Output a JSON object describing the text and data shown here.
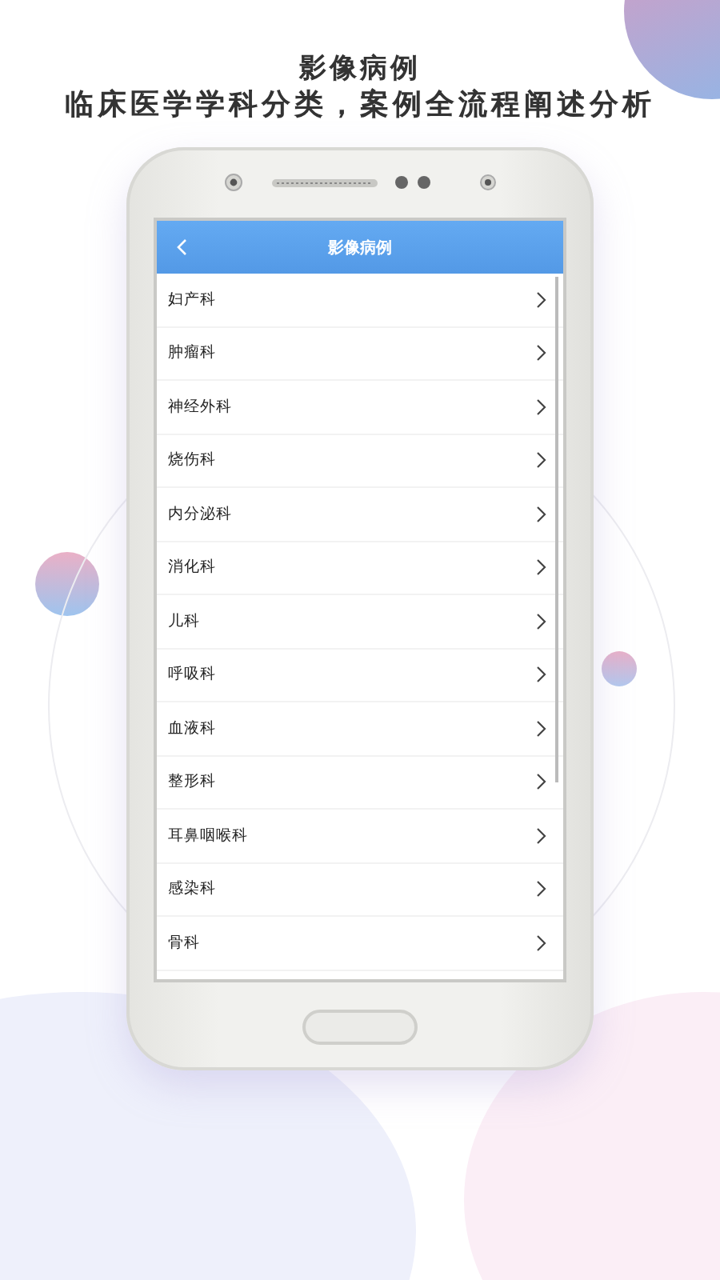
{
  "headline": "影像病例",
  "subtitle": "临床医学学科分类，案例全流程阐述分析",
  "screen": {
    "title": "影像病例",
    "items": [
      "妇产科",
      "肿瘤科",
      "神经外科",
      "烧伤科",
      "内分泌科",
      "消化科",
      "儿科",
      "呼吸科",
      "血液科",
      "整形科",
      "耳鼻咽喉科",
      "感染科",
      "骨科"
    ]
  }
}
